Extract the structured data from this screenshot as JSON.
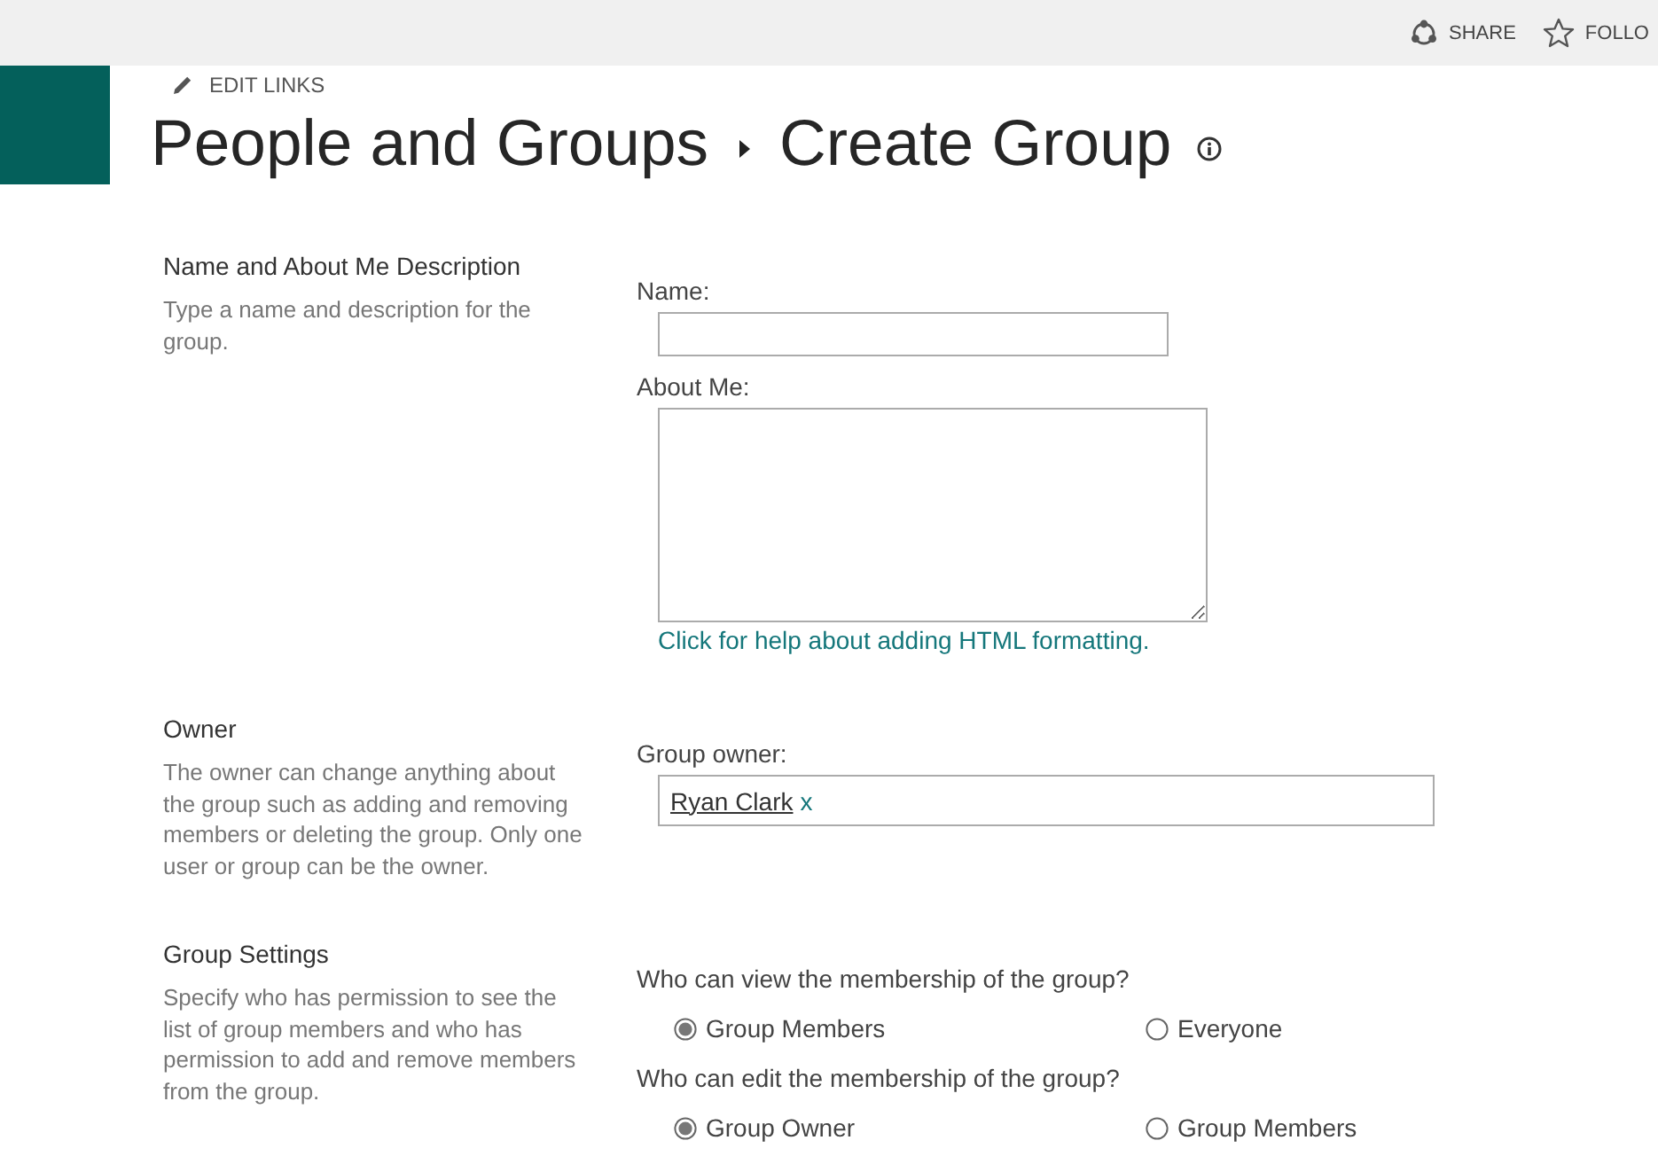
{
  "top_bar": {
    "actions": [
      {
        "kind": "share",
        "label": "SHARE"
      },
      {
        "kind": "follow",
        "label": "FOLLO"
      }
    ]
  },
  "edit_links": {
    "label": "EDIT LINKS"
  },
  "title": {
    "breadcrumb": "People and Groups",
    "current": "Create Group"
  },
  "sections": [
    {
      "heading": "Name and About Me Description",
      "description": "Type a name and description for the group.",
      "fields": [
        {
          "kind": "text",
          "label": "Name:"
        },
        {
          "kind": "textarea",
          "label": "About Me:",
          "help_link": "Click for help about adding HTML formatting."
        }
      ]
    },
    {
      "heading": "Owner",
      "description": "The owner can change anything about the group such as adding and removing members or deleting the group. Only one user or group can be the owner.",
      "fields": [
        {
          "kind": "people",
          "label": "Group owner:",
          "value": "Ryan Clark",
          "remove": "x"
        }
      ]
    },
    {
      "heading": "Group Settings",
      "description": "Specify who has permission to see the list of group members and who has permission to add and remove members from the group.",
      "fields": [
        {
          "kind": "radio",
          "label": "Who can view the membership of the group?",
          "options": [
            {
              "label": "Group Members",
              "selected": true
            },
            {
              "label": "Everyone",
              "selected": false
            }
          ]
        },
        {
          "kind": "radio",
          "label": "Who can edit the membership of the group?",
          "options": [
            {
              "label": "Group Owner",
              "selected": true
            },
            {
              "label": "Group Members",
              "selected": false
            }
          ]
        }
      ]
    }
  ]
}
